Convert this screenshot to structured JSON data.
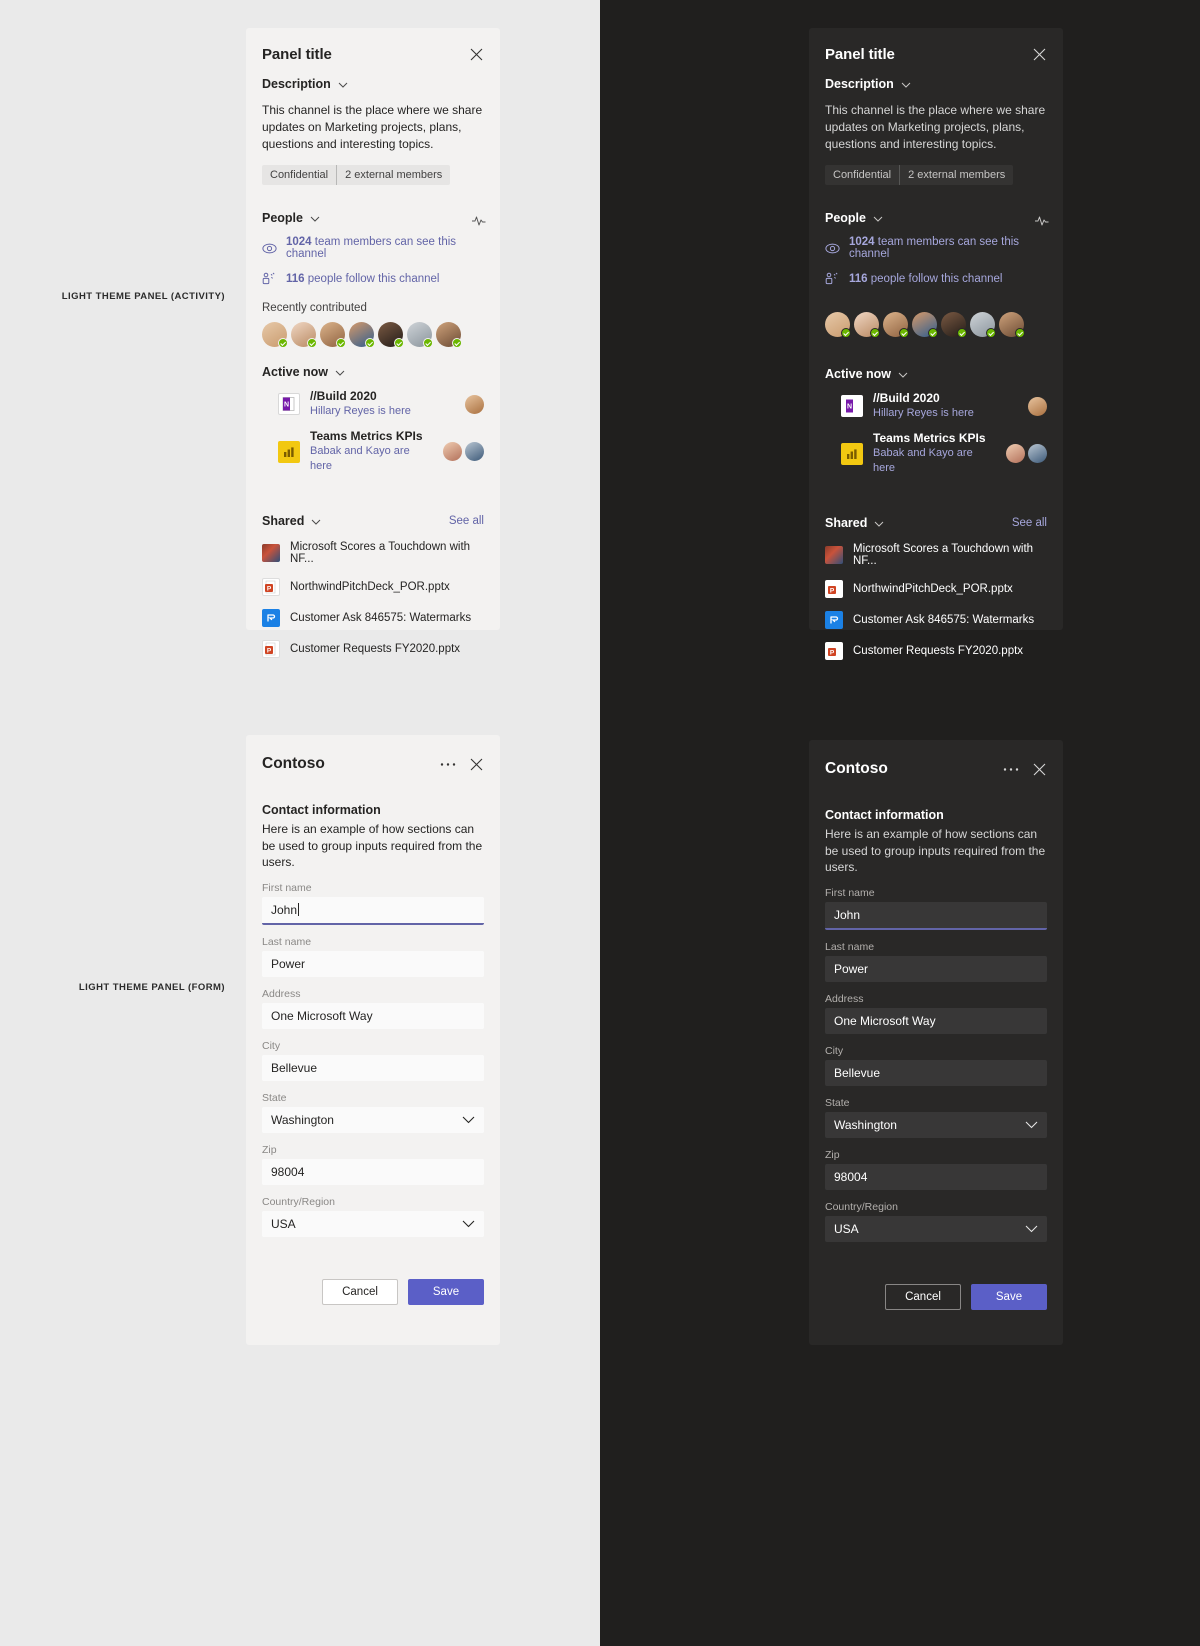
{
  "annotations": {
    "activity": "LIGHT THEME PANEL (ACTIVITY)",
    "form": "LIGHT THEME PANEL (FORM)"
  },
  "colors": {
    "accent": "#6264a7",
    "save_button": "#5b5fc7",
    "presence_available": "#6bb700",
    "light_panel_bg": "#f3f2f1",
    "dark_panel_bg": "#292827",
    "light_canvas": "#eaeaea",
    "dark_canvas": "#201f1e"
  },
  "activity_panel": {
    "title": "Panel title",
    "close_label": "close-icon",
    "activity_icon": "activity-pulse-icon",
    "description": {
      "heading": "Description",
      "body": "This channel is the place where we share updates on Marketing projects, plans, questions and interesting topics.",
      "tags": [
        "Confidential",
        "2 external members"
      ]
    },
    "people": {
      "heading": "People",
      "stats": [
        {
          "icon": "eye-icon",
          "count": "1024",
          "text": "team members can see this channel"
        },
        {
          "icon": "follow-people-icon",
          "count": "116",
          "text": "people follow this channel"
        }
      ],
      "recently_contributed_label": "Recently contributed",
      "avatar_count": 7
    },
    "active_now": {
      "heading": "Active now",
      "items": [
        {
          "app": "OneNote",
          "app_letter": "N",
          "title": "//Build 2020",
          "subtitle": "Hillary Reyes is here",
          "presence_avatars": 1
        },
        {
          "app": "Power BI",
          "app_letter": "",
          "title": "Teams Metrics KPIs",
          "subtitle": "Babak and Kayo are here",
          "presence_avatars": 2
        }
      ]
    },
    "shared": {
      "heading": "Shared",
      "see_all": "See all",
      "files": [
        {
          "type": "image",
          "name": "Microsoft Scores a Touchdown with NF..."
        },
        {
          "type": "pptx",
          "name": "NorthwindPitchDeck_POR.pptx"
        },
        {
          "type": "planner",
          "name": "Customer Ask 846575: Watermarks"
        },
        {
          "type": "pptx",
          "name": "Customer Requests FY2020.pptx"
        }
      ]
    }
  },
  "form_panel": {
    "title": "Contoso",
    "more_label": "more-options-icon",
    "close_label": "close-icon",
    "section": {
      "title": "Contact information",
      "description": "Here is an example of how sections can be used to group inputs required from the users."
    },
    "fields": [
      {
        "label": "First name",
        "value": "John",
        "type": "text",
        "focused": true
      },
      {
        "label": "Last name",
        "value": "Power",
        "type": "text",
        "focused": false
      },
      {
        "label": "Address",
        "value": "One Microsoft Way",
        "type": "text",
        "focused": false
      },
      {
        "label": "City",
        "value": "Bellevue",
        "type": "text",
        "focused": false
      },
      {
        "label": "State",
        "value": "Washington",
        "type": "select",
        "focused": false
      },
      {
        "label": "Zip",
        "value": "98004",
        "type": "text",
        "focused": false
      },
      {
        "label": "Country/Region",
        "value": "USA",
        "type": "select",
        "focused": false
      }
    ],
    "buttons": {
      "cancel": "Cancel",
      "save": "Save"
    }
  }
}
